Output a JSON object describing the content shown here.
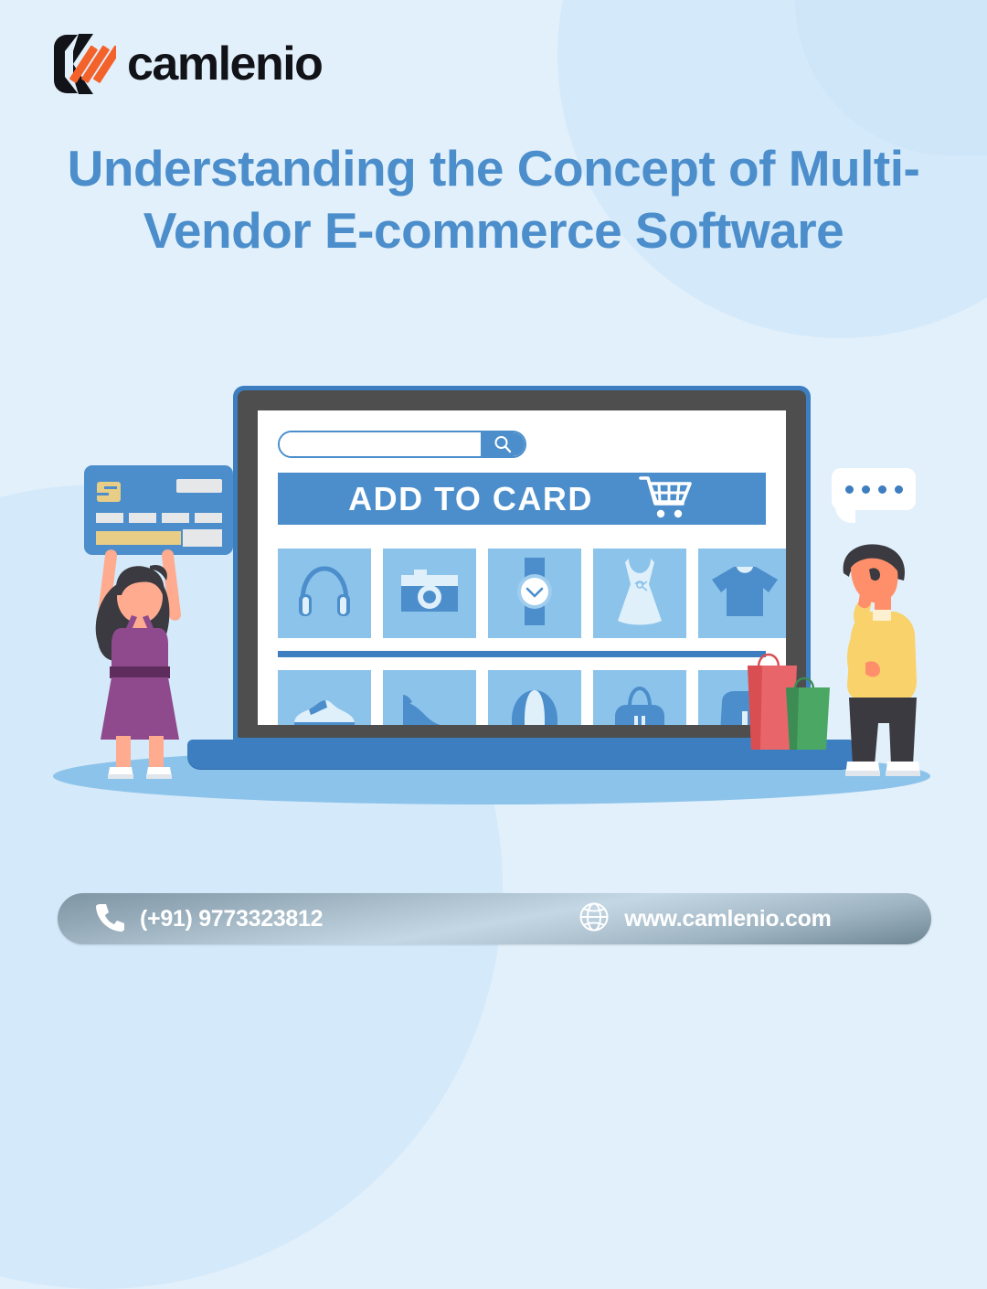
{
  "brand": {
    "logo_text": "camlenio",
    "logo_icon": "camlenio-bracket-mark",
    "accent_orange": "#f4622c",
    "accent_blue": "#4b8ecb",
    "mark_black": "#111318"
  },
  "headline": {
    "text": "Understanding the Concept of Multi-Vendor E-commerce Software",
    "color": "#4b8ecb"
  },
  "scene": {
    "laptop": {
      "frame_color": "#3d7ec0",
      "bezel_color": "#4e4e4e",
      "screen_color": "#ffffff",
      "search": {
        "value": "",
        "placeholder": "",
        "icon": "search-icon"
      },
      "banner": {
        "label": "ADD  TO  CARD",
        "icon": "shopping-cart-icon",
        "background": "#4b8ecb",
        "text_color": "#ffffff"
      },
      "product_rows": [
        {
          "items": [
            {
              "icon": "headphones-icon"
            },
            {
              "icon": "camera-icon"
            },
            {
              "icon": "wristwatch-icon"
            },
            {
              "icon": "dress-icon"
            },
            {
              "icon": "tshirt-icon"
            }
          ]
        },
        {
          "items": [
            {
              "icon": "sneaker-icon"
            },
            {
              "icon": "high-heel-icon"
            },
            {
              "icon": "cap-icon"
            },
            {
              "icon": "handbag-icon"
            },
            {
              "icon": "backpack-icon"
            }
          ]
        }
      ],
      "tile_color": "#8cc3ea",
      "divider_color": "#3d7ec0"
    },
    "credit_card": {
      "icon": "credit-card-icon",
      "body_color": "#4b8ecb",
      "chip_color": "#e8cd86",
      "stripe_color": "#e8cd86",
      "block_color": "#e6e7e8"
    },
    "speech_bubble": {
      "icon": "speech-bubble-icon",
      "dots": 4,
      "dot_color": "#3d7ec0",
      "bubble_color": "#ffffff"
    },
    "shopping_bags": [
      {
        "icon": "shopping-bag-icon",
        "color": "#e8666a"
      },
      {
        "icon": "shopping-bag-icon",
        "color": "#4aa864"
      }
    ],
    "characters": [
      {
        "name": "woman-holding-credit-card",
        "dress_color": "#8e4a8c",
        "hair_color": "#3a3a40",
        "skin_color": "#ffab8f",
        "shoe_color": "#ffffff"
      },
      {
        "name": "man-thinking",
        "sweater_color": "#f9d26b",
        "pants_color": "#3a3a40",
        "hair_color": "#3a3a40",
        "skin_color": "#ff8f6b",
        "shoe_color": "#ffffff"
      }
    ],
    "ground_color": "#8cc3ea"
  },
  "footer": {
    "phone_icon": "phone-icon",
    "phone": "(+91) 9773323812",
    "web_icon": "globe-icon",
    "website": "www.camlenio.com",
    "text_color": "#ffffff"
  },
  "background": {
    "base_color": "#e2f0fb",
    "decor_color": "#d4e9fa"
  }
}
